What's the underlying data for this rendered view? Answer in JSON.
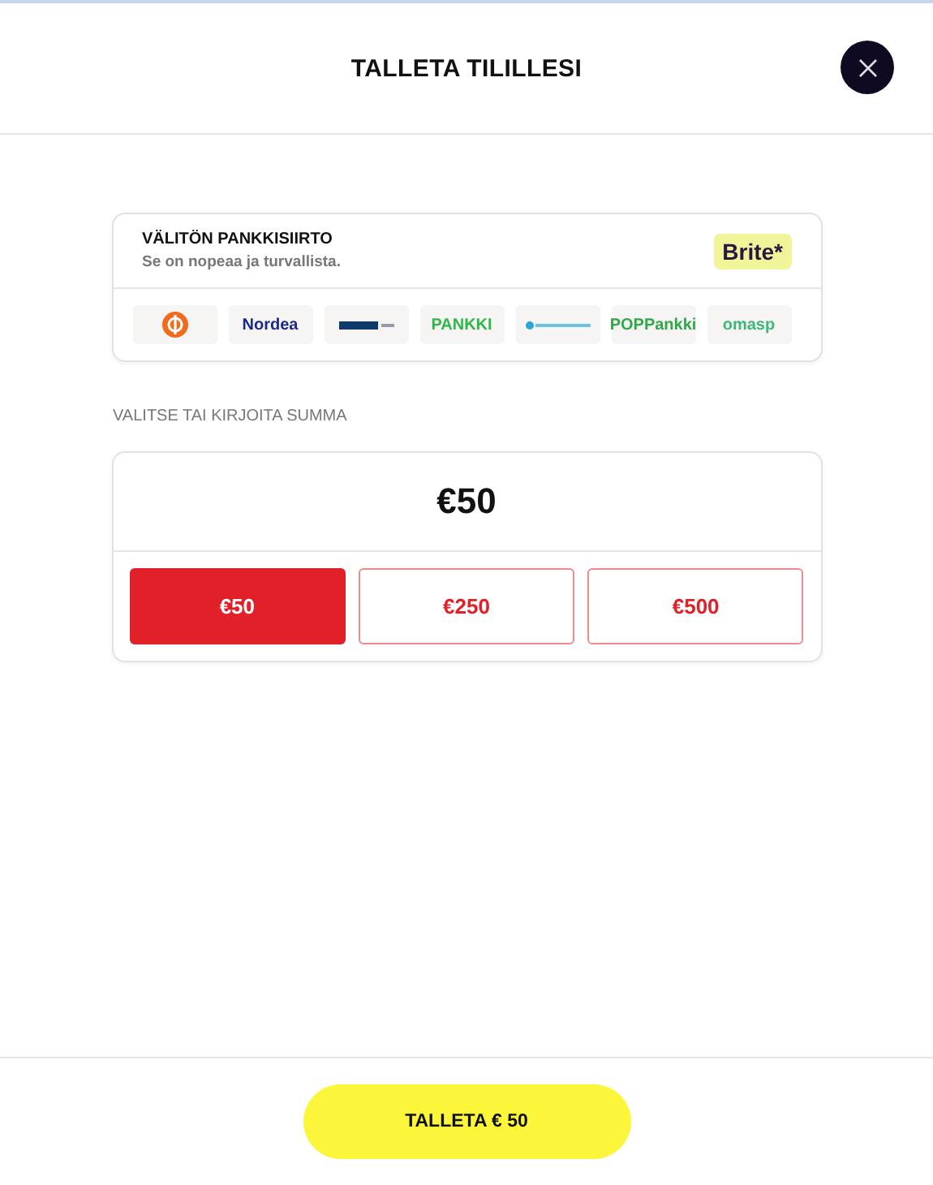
{
  "header": {
    "title": "TALLETA TILILLESI"
  },
  "transfer": {
    "title": "VÄLITÖN PANKKISIIRTO",
    "subtitle": "Se on nopeaa ja turvallista.",
    "provider": "Brite*",
    "banks": [
      {
        "kind": "op"
      },
      {
        "kind": "word",
        "label": "Nordea",
        "color": "#1b2a8a"
      },
      {
        "kind": "danske"
      },
      {
        "kind": "word",
        "label": "PANKKI",
        "color": "#2fb84a"
      },
      {
        "kind": "saasto"
      },
      {
        "kind": "word",
        "label": "POPPankki",
        "color": "#2fa84a"
      },
      {
        "kind": "word",
        "label": "omasp",
        "color": "#3bb87a"
      }
    ]
  },
  "amount": {
    "label": "VALITSE TAI KIRJOITA SUMMA",
    "value": "€50",
    "options": [
      {
        "label": "€50",
        "selected": true
      },
      {
        "label": "€250",
        "selected": false
      },
      {
        "label": "€500",
        "selected": false
      }
    ]
  },
  "footer": {
    "button": "TALLETA € 50"
  }
}
